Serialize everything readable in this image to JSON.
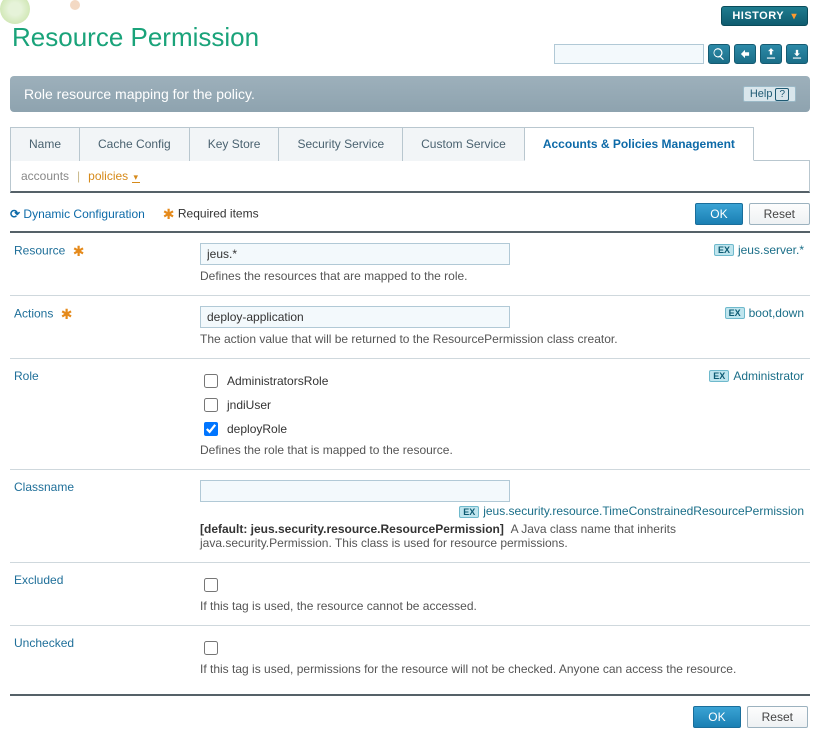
{
  "header": {
    "title": "Resource Permission",
    "history_label": "HISTORY",
    "banner_text": "Role resource mapping for the policy.",
    "help_label": "Help"
  },
  "tabs": [
    {
      "label": "Name",
      "active": false
    },
    {
      "label": "Cache Config",
      "active": false
    },
    {
      "label": "Key Store",
      "active": false
    },
    {
      "label": "Security Service",
      "active": false
    },
    {
      "label": "Custom Service",
      "active": false
    },
    {
      "label": "Accounts & Policies Management",
      "active": true
    }
  ],
  "breadcrumb": {
    "root": "accounts",
    "current": "policies"
  },
  "meta": {
    "dyn_conf": "Dynamic Configuration",
    "required": "Required items",
    "ok": "OK",
    "reset": "Reset"
  },
  "form": {
    "resource": {
      "label": "Resource",
      "value": "jeus.*",
      "helper": "Defines the resources that are mapped to the role.",
      "example": "jeus.server.*"
    },
    "actions": {
      "label": "Actions",
      "value": "deploy-application",
      "helper": "The action value that will be returned to the ResourcePermission class creator.",
      "example": "boot,down"
    },
    "role": {
      "label": "Role",
      "options": [
        {
          "label": "AdministratorsRole",
          "checked": false
        },
        {
          "label": "jndiUser",
          "checked": false
        },
        {
          "label": "deployRole",
          "checked": true
        }
      ],
      "helper": "Defines the role that is mapped to the resource.",
      "example": "Administrator"
    },
    "classname": {
      "label": "Classname",
      "value": "",
      "example": "jeus.security.resource.TimeConstrainedResourcePermission",
      "default_prefix": "[default: jeus.security.resource.ResourcePermission]",
      "helper": "A Java class name that inherits java.security.Permission. This class is used for resource permissions."
    },
    "excluded": {
      "label": "Excluded",
      "checked": false,
      "helper": "If this tag is used, the resource cannot be accessed."
    },
    "unchecked": {
      "label": "Unchecked",
      "checked": false,
      "helper": "If this tag is used, permissions for the resource will not be checked. Anyone can access the resource."
    }
  },
  "footer": {
    "ok": "OK",
    "reset": "Reset"
  }
}
